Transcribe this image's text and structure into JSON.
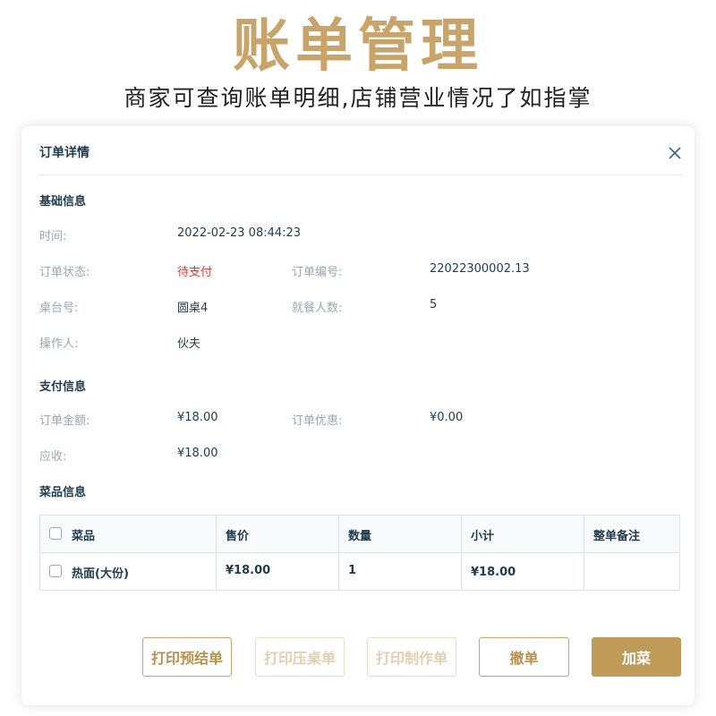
{
  "hero": {
    "title": "账单管理",
    "subtitle": "商家可查询账单明细,店铺营业情况了如指掌"
  },
  "dialog": {
    "title": "订单详情",
    "close_icon": "close-icon"
  },
  "basic": {
    "section_title": "基础信息",
    "time_label": "时间:",
    "time_value": "2022-02-23 08:44:23",
    "status_label": "订单状态:",
    "status_value": "待支付",
    "order_no_label": "订单编号:",
    "order_no_value": "22022300002.13",
    "table_label": "桌台号:",
    "table_value": "圆桌4",
    "diners_label": "就餐人数:",
    "diners_value": "5",
    "operator_label": "操作人:",
    "operator_value": "伙夫"
  },
  "payment": {
    "section_title": "支付信息",
    "amount_label": "订单金额:",
    "amount_value": "¥18.00",
    "discount_label": "订单优惠:",
    "discount_value": "¥0.00",
    "receivable_label": "应收:",
    "receivable_value": "¥18.00"
  },
  "dishes": {
    "section_title": "菜品信息",
    "columns": [
      "菜品",
      "售价",
      "数量",
      "小计",
      "整单备注"
    ],
    "rows": [
      {
        "name": "热面(大份)",
        "price": "¥18.00",
        "qty": "1",
        "subtotal": "¥18.00",
        "note": ""
      }
    ]
  },
  "actions": {
    "print_prebill": "打印预结单",
    "print_table": "打印压桌单",
    "print_kitchen": "打印制作单",
    "cancel_order": "撤单",
    "add_dish": "加菜"
  },
  "colors": {
    "accent": "#c9a46a",
    "primary_button": "#c09a58",
    "status_warn": "#e03a3a"
  }
}
